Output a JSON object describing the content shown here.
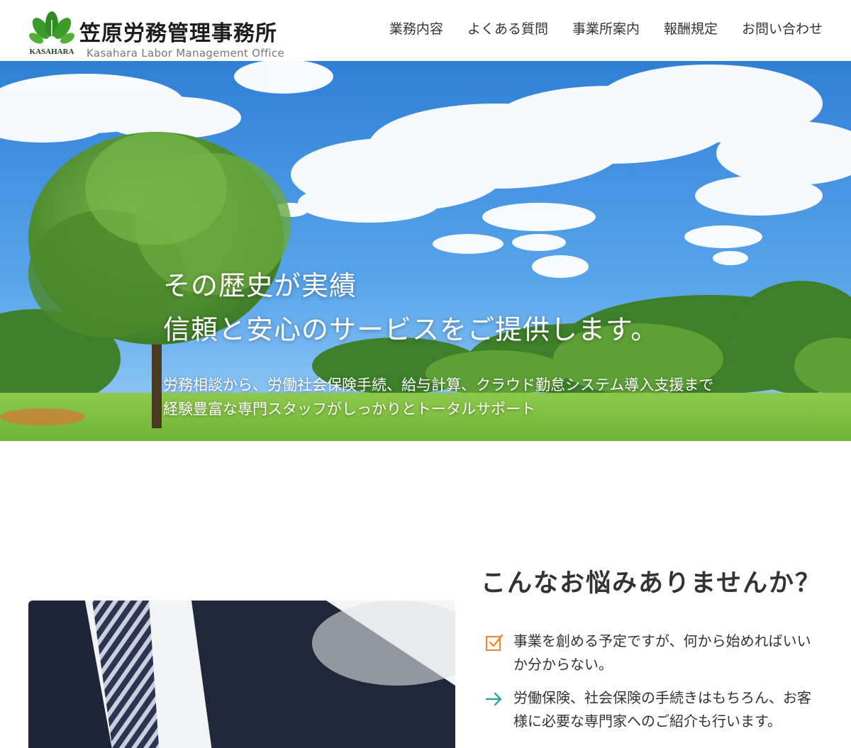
{
  "brand": {
    "name": "笠原労務管理事務所",
    "english_name": "Kasahara Labor Management Office",
    "mark_text": "KASAHARA"
  },
  "nav": {
    "items": [
      {
        "label": "業務内容"
      },
      {
        "label": "よくある質問"
      },
      {
        "label": "事業所案内"
      },
      {
        "label": "報酬規定"
      },
      {
        "label": "お問い合わせ"
      }
    ]
  },
  "hero": {
    "heading_line1": "その歴史が実績",
    "heading_line2": "信頼と安心のサービスをご提供します。",
    "sub_line1": "労務相談から、労働社会保険手続、給与計算、クラウド勤怠システム導入支援まで",
    "sub_line2": "経験豊富な専門スタッフがしっかりとトータルサポート"
  },
  "concerns": {
    "title": "こんなお悩みありませんか？",
    "items": [
      {
        "icon": "checkbox-icon",
        "text": "事業を創める予定ですが、何から始めればいいか分からない。"
      },
      {
        "icon": "arrow-right-icon",
        "text": "労働保険、社会保険の手続きはもちろん、お客様に必要な専門家へのご紹介も行います。"
      }
    ]
  },
  "colors": {
    "logo_green": "#3f9a2c",
    "check_orange": "#f0883a",
    "arrow_teal": "#2aa89a",
    "sky": "#3d8fe0"
  }
}
